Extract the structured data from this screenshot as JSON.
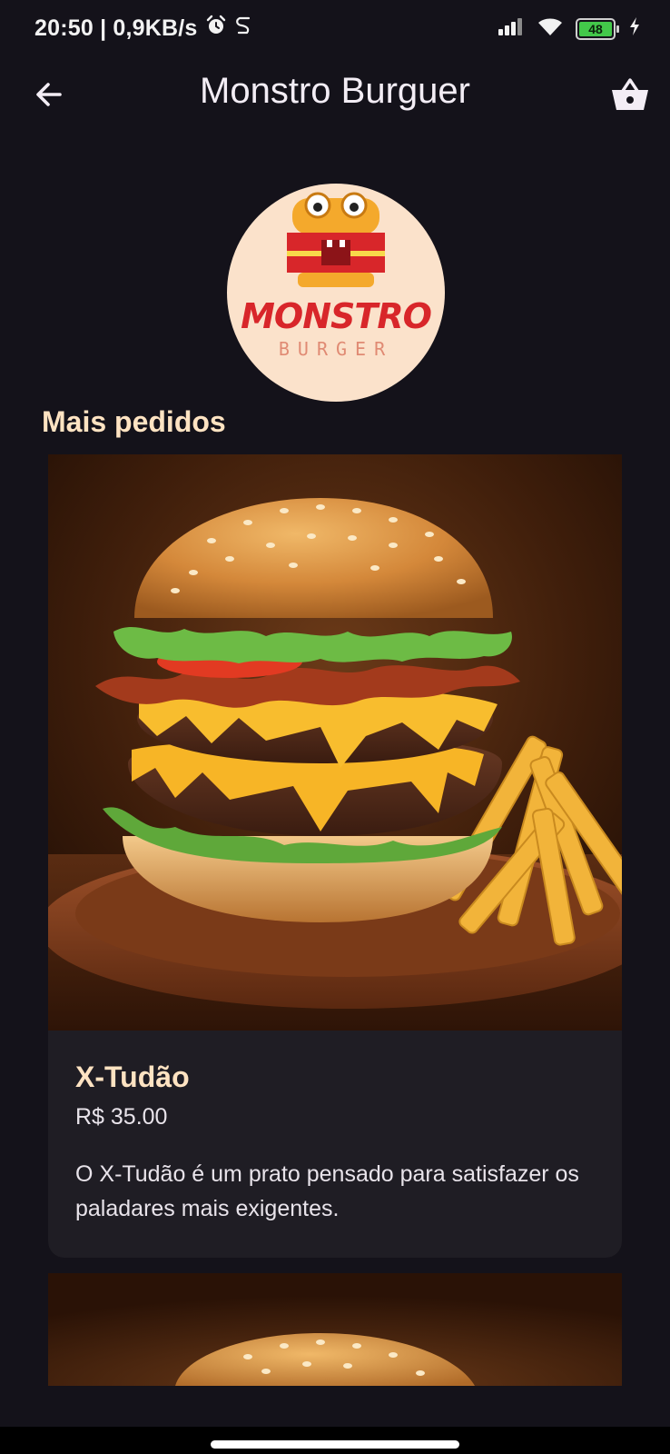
{
  "status_bar": {
    "time_speed": "20:50 | 0,9KB/s",
    "battery": "48",
    "icons": [
      "alarm-icon",
      "data-saver-icon",
      "signal-icon",
      "wifi-icon",
      "battery-icon",
      "charging-icon"
    ]
  },
  "app_bar": {
    "title": "Monstro Burguer",
    "back_icon": "arrow-left-icon",
    "cart_icon": "shopping-basket-icon"
  },
  "logo": {
    "word": "MONSTRO",
    "sub": "BURGER"
  },
  "section": {
    "title": "Mais pedidos"
  },
  "products": [
    {
      "name": "X-Tudão",
      "price": "R$ 35.00",
      "description": "O X-Tudão é um prato pensado para satisfazer os paladares mais exigentes."
    }
  ],
  "colors": {
    "background": "#14121a",
    "card": "#1f1d24",
    "accent_text": "#ffe3c2",
    "logo_red": "#d8262a",
    "logo_bg": "#fbe2cb",
    "battery_green": "#43c84a"
  }
}
